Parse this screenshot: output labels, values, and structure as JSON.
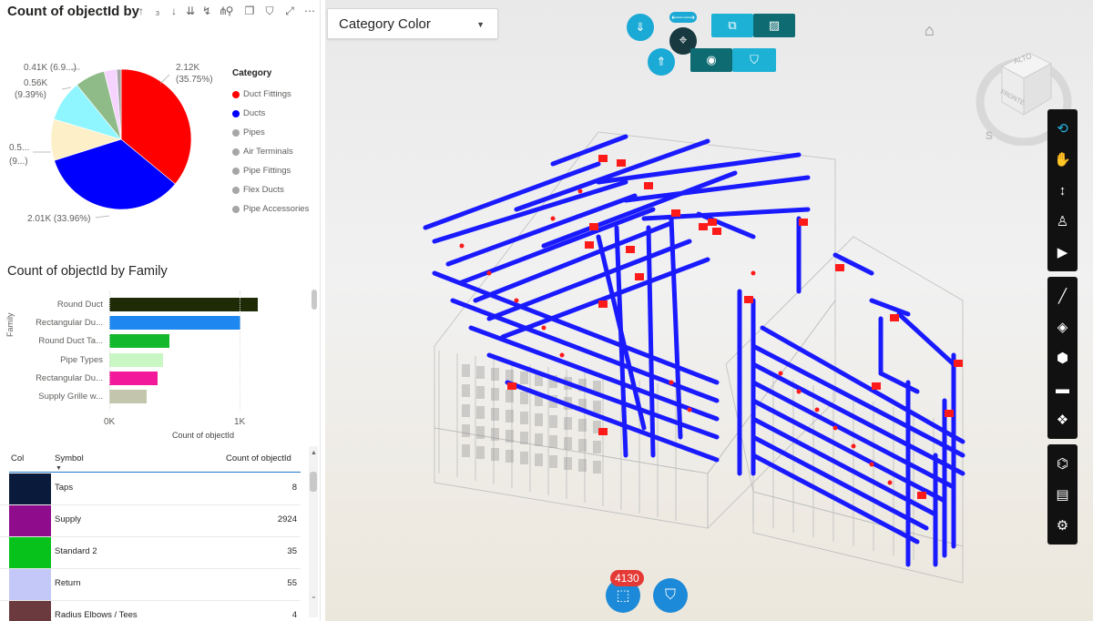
{
  "pie_visual": {
    "title": "Count of objectId by",
    "sort_icons": "↑ ₃ ↓ ↓ ⇊ ⇄",
    "legend_title": "Category",
    "legend_items": [
      {
        "label": "Duct Fittings",
        "color": "#ff0000"
      },
      {
        "label": "Ducts",
        "color": "#0000ff"
      },
      {
        "label": "Pipes",
        "color": "#a6a6a6"
      },
      {
        "label": "Air Terminals",
        "color": "#a6a6a6"
      },
      {
        "label": "Pipe Fittings",
        "color": "#a6a6a6"
      },
      {
        "label": "Flex Ducts",
        "color": "#a6a6a6"
      },
      {
        "label": "Pipe Accessories",
        "color": "#a6a6a6"
      }
    ],
    "labels": {
      "top_right_1": "2.12K",
      "top_right_2": "(35.75%)",
      "bottom": "2.01K (33.96%)",
      "l1": "0.41K (6.9...)",
      "l2a": "0.56K",
      "l2b": "(9.39%)",
      "l3a": "0.5...",
      "l3b": "(9...)"
    }
  },
  "bar_visual": {
    "title": "Count of objectId by Family",
    "ylabel": "Family",
    "xlabel": "Count of objectId",
    "ticks": [
      "0K",
      "1K"
    ]
  },
  "table": {
    "headers": {
      "col": "Col",
      "symbol": "Symbol",
      "count": "Count of objectId"
    },
    "rows": [
      {
        "color": "#0a1a3a",
        "symbol": "Taps",
        "count": "8"
      },
      {
        "color": "#8f0c8c",
        "symbol": "Supply",
        "count": "2924"
      },
      {
        "color": "#06c21b",
        "symbol": "Standard 2",
        "count": "35"
      },
      {
        "color": "#c4c8f8",
        "symbol": "Return",
        "count": "55"
      },
      {
        "color": "#6b3a3e",
        "symbol": "Radius Elbows / Tees",
        "count": "4"
      }
    ]
  },
  "viewer": {
    "dropdown_value": "Category Color",
    "selection_count": "4130",
    "cube_labels": {
      "top": "ALTO",
      "front": "FRONTE",
      "south": "S"
    }
  },
  "chart_data": [
    {
      "type": "pie",
      "title": "Count of objectId by",
      "legend_title": "Category",
      "slices": [
        {
          "label": "Duct Fittings",
          "value": 2120,
          "percent": 35.75,
          "color": "#ff0000"
        },
        {
          "label": "Ducts",
          "value": 2010,
          "percent": 33.96,
          "color": "#0000ff"
        },
        {
          "label": "",
          "value": 560,
          "percent": 9.39,
          "color": "#fdf0c8"
        },
        {
          "label": "",
          "value": 560,
          "percent": 9.39,
          "color": "#8ff6ff"
        },
        {
          "label": "",
          "value": 410,
          "percent": 6.9,
          "color": "#8fbb88"
        },
        {
          "label": "",
          "value": 170,
          "percent": 2.9,
          "color": "#f6d4ff"
        },
        {
          "label": "",
          "value": 60,
          "percent": 1.0,
          "color": "#a6a6a6"
        }
      ]
    },
    {
      "type": "bar",
      "orientation": "horizontal",
      "title": "Count of objectId by Family",
      "ylabel": "Family",
      "xlabel": "Count of objectId",
      "categories": [
        "Round Duct",
        "Rectangular Du...",
        "Round Duct Ta...",
        "Pipe Types",
        "Rectangular Du...",
        "Supply Grille w..."
      ],
      "values": [
        1140,
        1010,
        460,
        410,
        370,
        290
      ],
      "colors": [
        "#1f2a06",
        "#1e88f0",
        "#14b82d",
        "#c9f7c4",
        "#f21a9a",
        "#c3c6ac"
      ],
      "xlim": [
        0,
        1150
      ]
    }
  ]
}
